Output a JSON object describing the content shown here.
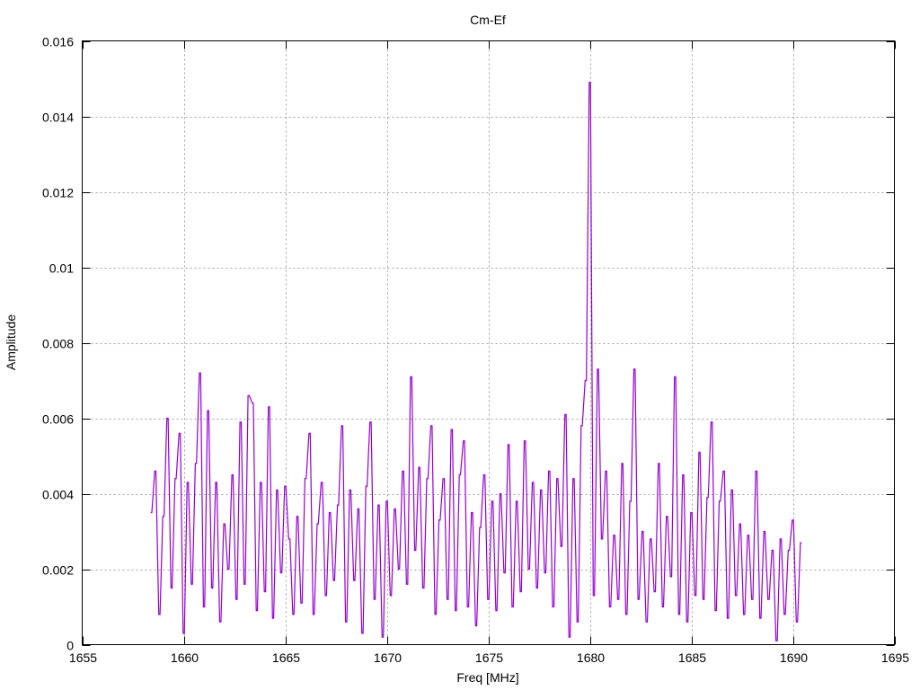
{
  "chart_data": {
    "type": "line",
    "style": "steps",
    "title": "Cm-Ef",
    "xlabel": "Freq [MHz]",
    "ylabel": "Amplitude",
    "xlim": [
      1655,
      1695
    ],
    "ylim": [
      0,
      0.016
    ],
    "grid": true,
    "x_ticks": [
      1655,
      1660,
      1665,
      1670,
      1675,
      1680,
      1685,
      1690,
      1695
    ],
    "x_tick_labels": [
      "1655",
      "1660",
      "1665",
      "1670",
      "1675",
      "1680",
      "1685",
      "1690",
      "1695"
    ],
    "y_ticks": [
      0,
      0.002,
      0.004,
      0.006,
      0.008,
      0.01,
      0.012,
      0.014,
      0.016
    ],
    "y_tick_labels": [
      "0",
      "0.002",
      "0.004",
      "0.006",
      "0.008",
      "0.01",
      "0.012",
      "0.014",
      "0.016"
    ],
    "series": [
      {
        "name": "Cm-Ef",
        "color": "#9400d3",
        "x_start": 1658.4,
        "x_step": 0.2,
        "values": [
          0.0035,
          0.0046,
          0.0008,
          0.0034,
          0.006,
          0.0015,
          0.0044,
          0.0056,
          0.0003,
          0.0043,
          0.0016,
          0.0048,
          0.0072,
          0.001,
          0.0062,
          0.0015,
          0.0043,
          0.0006,
          0.0032,
          0.002,
          0.0045,
          0.0012,
          0.0059,
          0.0016,
          0.0066,
          0.0064,
          0.0009,
          0.0043,
          0.0014,
          0.0063,
          0.0007,
          0.0041,
          0.0019,
          0.0042,
          0.0028,
          0.0008,
          0.0034,
          0.0011,
          0.0044,
          0.0056,
          0.0008,
          0.0032,
          0.0043,
          0.0013,
          0.0035,
          0.0017,
          0.0037,
          0.0058,
          0.0006,
          0.0041,
          0.0017,
          0.0036,
          0.0003,
          0.0042,
          0.0059,
          0.0012,
          0.0037,
          0.0002,
          0.0038,
          0.0013,
          0.0036,
          0.002,
          0.0046,
          0.0016,
          0.0071,
          0.0025,
          0.0047,
          0.0015,
          0.0044,
          0.0058,
          0.0008,
          0.0033,
          0.0044,
          0.0012,
          0.0057,
          0.0009,
          0.0045,
          0.0054,
          0.001,
          0.0035,
          0.0005,
          0.0031,
          0.0045,
          0.0012,
          0.0038,
          0.0009,
          0.004,
          0.0019,
          0.0053,
          0.001,
          0.0038,
          0.0014,
          0.0054,
          0.002,
          0.0043,
          0.0015,
          0.0041,
          0.0019,
          0.0046,
          0.001,
          0.0044,
          0.0026,
          0.0061,
          0.0002,
          0.0044,
          0.0006,
          0.0058,
          0.007,
          0.0149,
          0.0013,
          0.0073,
          0.0028,
          0.0046,
          0.001,
          0.0029,
          0.0012,
          0.0048,
          0.0008,
          0.0038,
          0.0073,
          0.0012,
          0.003,
          0.0006,
          0.0028,
          0.0014,
          0.0048,
          0.001,
          0.0034,
          0.0018,
          0.0071,
          0.0008,
          0.0045,
          0.0006,
          0.0035,
          0.0013,
          0.0051,
          0.0012,
          0.0039,
          0.0059,
          0.0009,
          0.0038,
          0.0046,
          0.0007,
          0.0041,
          0.0013,
          0.0032,
          0.0008,
          0.0029,
          0.0012,
          0.0046,
          0.0007,
          0.003,
          0.0012,
          0.0025,
          0.0001,
          0.0028,
          0.0008,
          0.0025,
          0.0033,
          0.0006,
          0.0027
        ]
      }
    ]
  }
}
